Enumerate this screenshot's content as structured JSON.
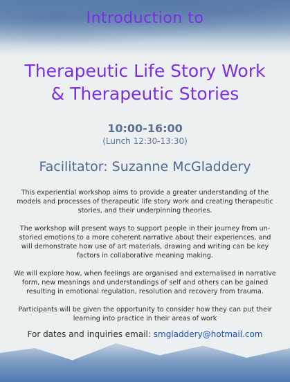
{
  "intro": "Introduction to",
  "title_line1": "Therapeutic Life Story Work",
  "title_line2": "& Therapeutic Stories",
  "time": "10:00-16:00",
  "lunch": "(Lunch 12:30-13:30)",
  "facilitator": "Facilitator: Suzanne McGladdery",
  "paragraphs": [
    "This experiential workshop aims to provide a greater understanding of the models and processes of therapeutic life story work and creating therapeutic stories, and their underpinning theories.",
    "The workshop will present ways to support people in their journey from un-storied emotions to a more coherent narrative about their experiences, and will demonstrate how use of art materials, drawing and writing can be key factors in collaborative meaning making.",
    "We will explore how, when feelings are organised and externalised in narrative form, new meanings and understandings of self and others can be gained resulting in emotional regulation, resolution and recovery from trauma.",
    "Participants will be given the opportunity to consider how they can put their learning into practice in their areas of work"
  ],
  "contact_label": "For dates and inquiries email:",
  "email": "smgladdery@hotmail.com",
  "colors": {
    "title": "#7a2fe6",
    "facilitator": "#4e6990",
    "email": "#1c4fb5"
  }
}
